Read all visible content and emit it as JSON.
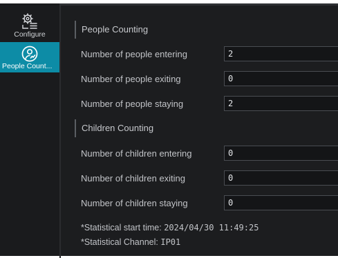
{
  "sidebar": {
    "items": [
      {
        "label": "Configure",
        "icon": "gear-list-icon"
      },
      {
        "label": "People Count...",
        "icon": "people-count-icon",
        "active": true
      }
    ]
  },
  "people_counting": {
    "title": "People Counting",
    "rows": [
      {
        "label": "Number of people entering",
        "value": "2"
      },
      {
        "label": "Number of people exiting",
        "value": "0"
      },
      {
        "label": "Number of people staying",
        "value": "2"
      }
    ]
  },
  "children_counting": {
    "title": "Children Counting",
    "rows": [
      {
        "label": "Number of children entering",
        "value": "0"
      },
      {
        "label": "Number of children exiting",
        "value": "0"
      },
      {
        "label": "Number of children staying",
        "value": "0"
      }
    ]
  },
  "notes": {
    "start_time_label": "*Statistical start time: ",
    "start_time_value": "2024/04/30 11:49:25",
    "channel_label": "*Statistical Channel: ",
    "channel_value": "IP01"
  },
  "colors": {
    "accent": "#0d8ca6",
    "background": "#1c1d1f"
  }
}
